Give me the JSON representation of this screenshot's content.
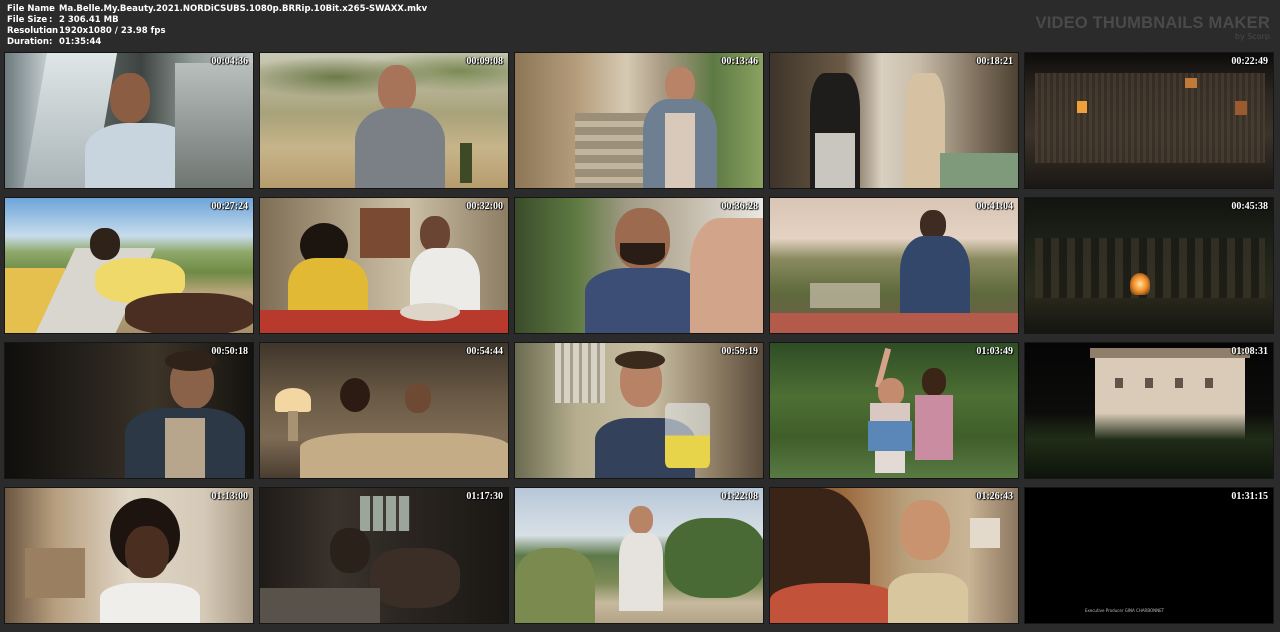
{
  "file_info": {
    "rows": [
      {
        "label": "File Name",
        "value": "Ma.Belle.My.Beauty.2021.NORDiCSUBS.1080p.BRRip.10Bit.x265-SWAXX.mkv"
      },
      {
        "label": "File Size",
        "value": "2 306.41 MB"
      },
      {
        "label": "Resolution",
        "value": "1920x1080 / 23.98 fps"
      },
      {
        "label": "Duration",
        "value": "01:35:44"
      }
    ],
    "separator": ":"
  },
  "brand": {
    "title": "VIDEO THUMBNAILS MAKER",
    "subtitle": "by Scorp"
  },
  "colors": {
    "background": "#2b2b2b",
    "brand_text": "#4a4a4a"
  },
  "thumbnails": [
    {
      "time": "00:04:36",
      "scene": "car"
    },
    {
      "time": "00:09:08",
      "scene": "orchard"
    },
    {
      "time": "00:13:46",
      "scene": "stairs"
    },
    {
      "time": "00:18:21",
      "scene": "kitchen"
    },
    {
      "time": "00:22:49",
      "scene": "night-house"
    },
    {
      "time": "00:27:24",
      "scene": "sunbath"
    },
    {
      "time": "00:32:00",
      "scene": "dinner"
    },
    {
      "time": "00:36:28",
      "scene": "man-closeup"
    },
    {
      "time": "00:41:04",
      "scene": "terrace"
    },
    {
      "time": "00:45:38",
      "scene": "campfire"
    },
    {
      "time": "00:50:18",
      "scene": "dark-portrait"
    },
    {
      "time": "00:54:44",
      "scene": "bed-lamp"
    },
    {
      "time": "00:59:19",
      "scene": "juice"
    },
    {
      "time": "01:03:49",
      "scene": "dancing"
    },
    {
      "time": "01:08:31",
      "scene": "night-villa"
    },
    {
      "time": "01:13:00",
      "scene": "curly-hair"
    },
    {
      "time": "01:17:30",
      "scene": "dark-room"
    },
    {
      "time": "01:22:08",
      "scene": "path"
    },
    {
      "time": "01:26:43",
      "scene": "laughing"
    },
    {
      "time": "01:31:15",
      "scene": "credits",
      "credit_text": "Executive Producer     GINA CHARBONNET"
    }
  ]
}
